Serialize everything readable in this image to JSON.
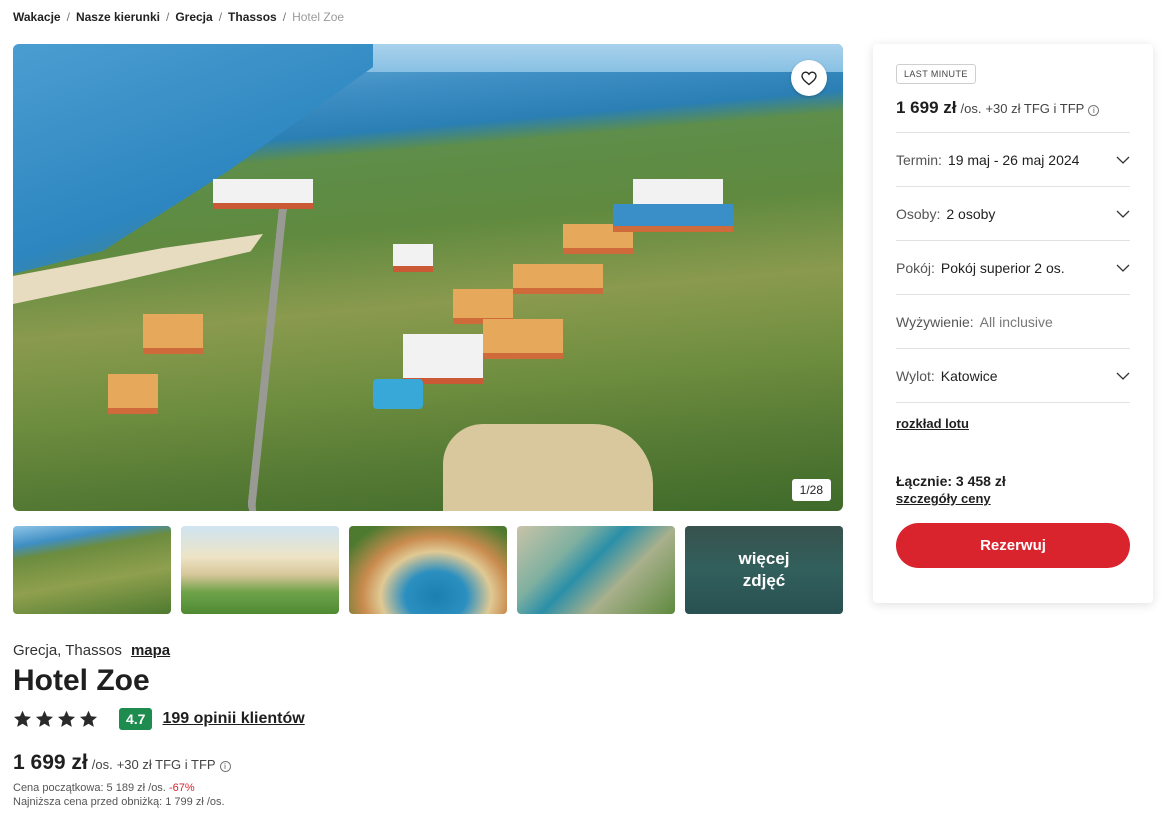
{
  "breadcrumb": {
    "items": [
      "Wakacje",
      "Nasze kierunki",
      "Grecja",
      "Thassos"
    ],
    "current": "Hotel Zoe",
    "separator": "/"
  },
  "gallery": {
    "counter": "1/28",
    "more_photos_line1": "więcej",
    "more_photos_line2": "zdjęć",
    "favorite_icon": "heart-icon"
  },
  "booking": {
    "tag": "LAST MINUTE",
    "price": "1 699 zł",
    "per_person": "/os.",
    "extra": "+30 zł TFG i TFP",
    "info_icon": "i",
    "term_label": "Termin:",
    "term_value": "19 maj - 26 maj 2024",
    "persons_label": "Osoby:",
    "persons_value": "2 osoby",
    "room_label": "Pokój:",
    "room_value": "Pokój superior 2 os.",
    "board_label": "Wyżywienie:",
    "board_value": "All inclusive",
    "departure_label": "Wylot:",
    "departure_value": "Katowice",
    "flights_link": "rozkład lotu",
    "total": "Łącznie: 3 458 zł",
    "price_details_link": "szczegóły ceny",
    "book_button": "Rezerwuj"
  },
  "hotel": {
    "location": "Grecja, Thassos",
    "map_link": "mapa",
    "name": "Hotel Zoe",
    "stars": 4,
    "score": "4.7",
    "reviews_link": "199 opinii klientów",
    "price": "1 699 zł",
    "per_person": "/os.",
    "extra": "+30 zł TFG i TFP",
    "info_icon": "i",
    "original_price": "Cena początkowa: 5 189 zł /os.",
    "discount": "-67%",
    "lowest_price": "Najniższa cena przed obniżką: 1 799 zł /os."
  },
  "colors": {
    "accent_red": "#d9232d",
    "score_green": "#1e8c4e"
  }
}
